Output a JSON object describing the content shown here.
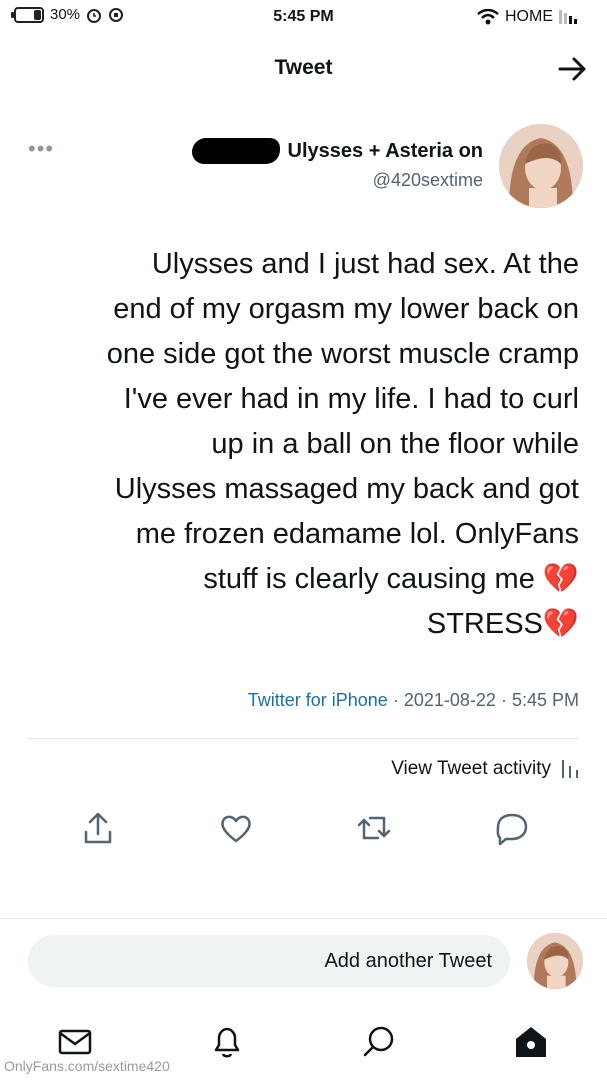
{
  "status_bar": {
    "time": "5:45 PM",
    "carrier": "HOME",
    "battery_percent": "30%",
    "battery_level": 0.3
  },
  "header": {
    "title": "Tweet",
    "back_icon": "arrow-icon"
  },
  "author": {
    "display_name": "Ulysses + Asteria on",
    "handle": "@420sextime",
    "more_icon": "more-icon"
  },
  "tweet": {
    "lines": [
      "Ulysses and I just had sex. At the",
      "end of my orgasm my lower back on",
      "one side got the worst muscle cramp",
      "I've ever had in my life. I had to curl",
      "up in a ball on the floor while",
      "Ulysses massaged my back and got",
      "me frozen edamame lol. OnlyFans",
      "stuff is clearly causing me 💔",
      "STRESS💔"
    ],
    "time": "5:45 PM",
    "date": "2021-08-22",
    "source": "Twitter for iPhone",
    "separator": "·"
  },
  "activity": {
    "label": "View Tweet activity"
  },
  "reply": {
    "placeholder": "Add another Tweet"
  },
  "watermark": "OnlyFans.com/sextime420"
}
